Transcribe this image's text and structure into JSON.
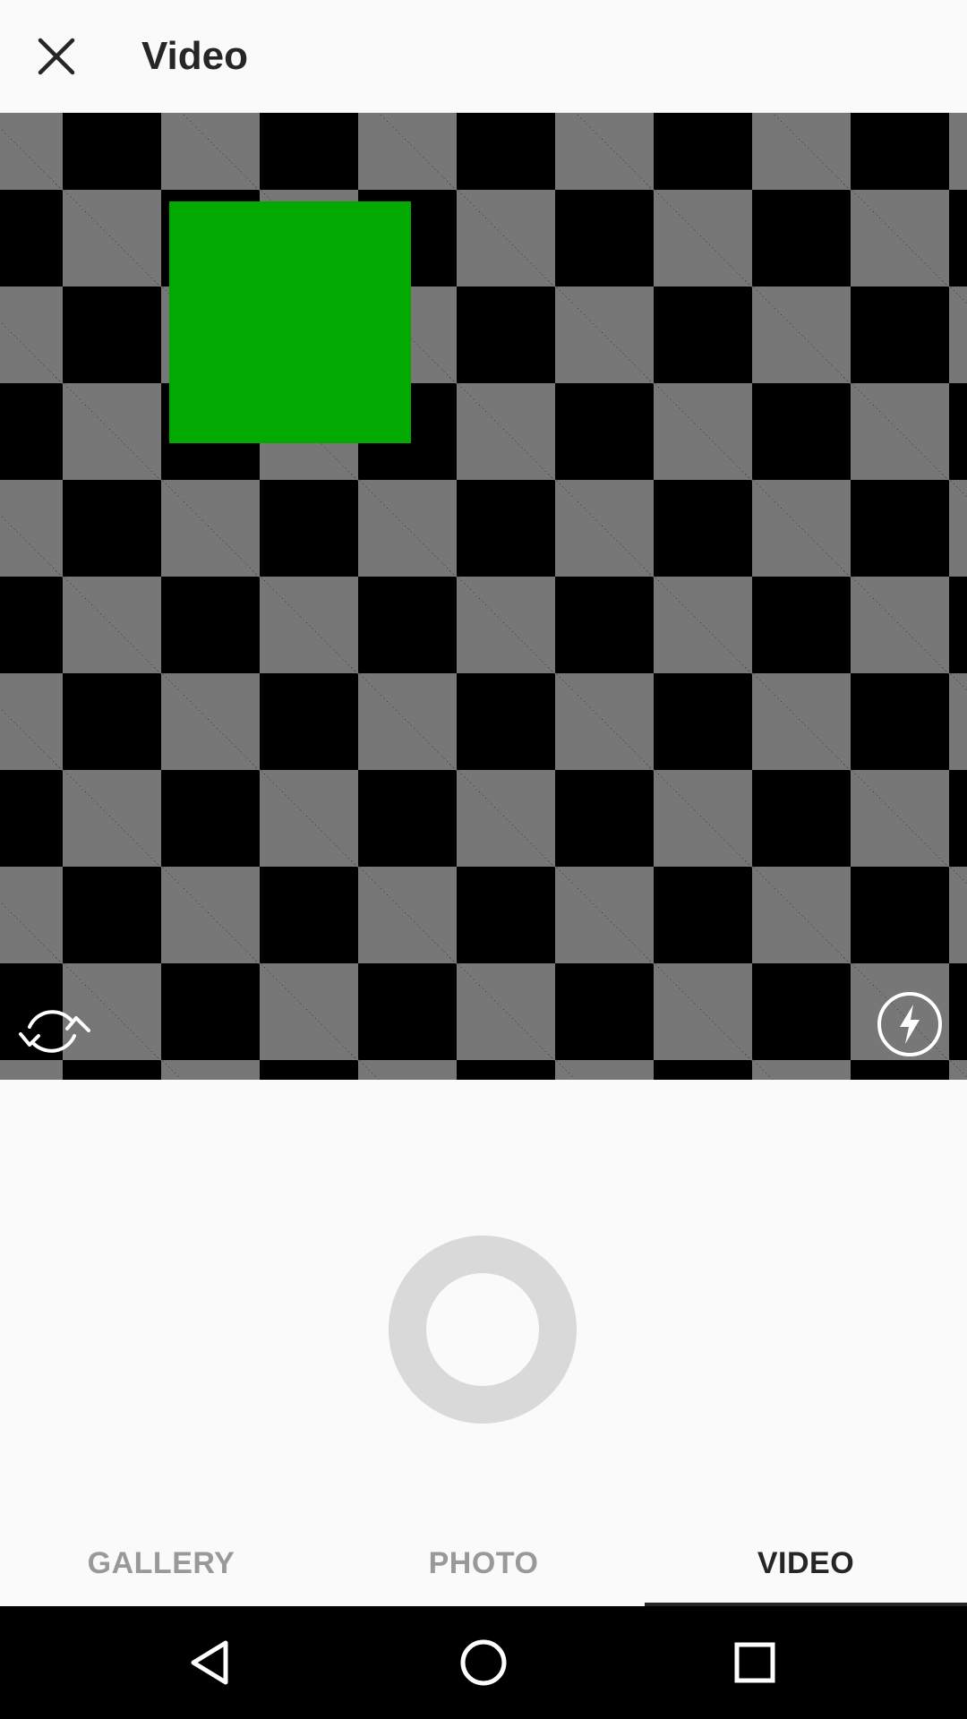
{
  "header": {
    "title": "Video",
    "close_icon": "close-icon"
  },
  "preview": {
    "switch_camera_icon": "switch-camera-icon",
    "flash_icon": "flash-icon",
    "colors": {
      "checker_light": "#777777",
      "checker_dark": "#000000",
      "object": "#00aa00"
    }
  },
  "capture": {
    "record_button_icon": "record-ring-icon",
    "ring_color": "#d9d9d9"
  },
  "tabs": [
    {
      "label": "GALLERY",
      "active": false
    },
    {
      "label": "PHOTO",
      "active": false
    },
    {
      "label": "VIDEO",
      "active": true
    }
  ],
  "navbar": {
    "back_icon": "back-triangle-icon",
    "home_icon": "home-circle-icon",
    "recents_icon": "recents-square-icon"
  }
}
